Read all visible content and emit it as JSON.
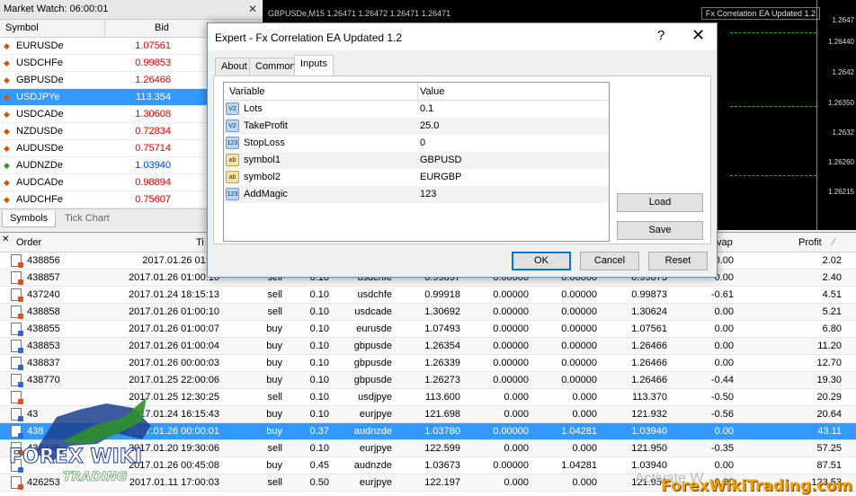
{
  "market_watch": {
    "title": "Market Watch: 06:00:01",
    "col_symbol": "Symbol",
    "col_bid": "Bid",
    "rows": [
      {
        "symbol": "EURUSDe",
        "bid": "1.07561"
      },
      {
        "symbol": "USDCHFe",
        "bid": "0.99853"
      },
      {
        "symbol": "GBPUSDe",
        "bid": "1.26466"
      },
      {
        "symbol": "USDJPYe",
        "bid": "113.354"
      },
      {
        "symbol": "USDCADe",
        "bid": "1.30608"
      },
      {
        "symbol": "NZDUSDe",
        "bid": "0.72834"
      },
      {
        "symbol": "AUDUSDe",
        "bid": "0.75714"
      },
      {
        "symbol": "AUDNZDe",
        "bid": "1.03940"
      },
      {
        "symbol": "AUDCADe",
        "bid": "0.98894"
      },
      {
        "symbol": "AUDCHFe",
        "bid": "0.75607"
      }
    ],
    "tabs": [
      "Symbols",
      "Tick Chart"
    ]
  },
  "chart": {
    "title": "GBPUSDe,M15  1.26471 1.26472 1.26471 1.26471",
    "ea_label": "Fx Correlation EA Updated 1.2",
    "price_labels": [
      "1.2647",
      "1.26440",
      "1.2642",
      "1.26350",
      "1.2632",
      "1.26260",
      "1.26215"
    ]
  },
  "dialog": {
    "title": "Expert - Fx Correlation EA Updated 1.2",
    "help": "?",
    "close": "✕",
    "tabs": [
      "About",
      "Common",
      "Inputs"
    ],
    "grid_headers": {
      "variable": "Variable",
      "value": "Value"
    },
    "inputs": [
      {
        "type": "V2",
        "name": "Lots",
        "value": "0.1"
      },
      {
        "type": "V2",
        "name": "TakeProfit",
        "value": "25.0"
      },
      {
        "type": "123",
        "name": "StopLoss",
        "value": "0"
      },
      {
        "type": "ab",
        "name": "symbol1",
        "value": "GBPUSD"
      },
      {
        "type": "ab",
        "name": "symbol2",
        "value": "EURGBP"
      },
      {
        "type": "123",
        "name": "AddMagic",
        "value": "123"
      }
    ],
    "buttons": {
      "load": "Load",
      "save": "Save",
      "ok": "OK",
      "cancel": "Cancel",
      "reset": "Reset"
    }
  },
  "terminal": {
    "headers": {
      "order": "Order",
      "time": "Ti",
      "swap": "vap",
      "profit": "Profit"
    },
    "rows": [
      {
        "order": "438856",
        "time": "2017.01.26 01:00",
        "type": "",
        "size": "",
        "symbol": "",
        "price": "",
        "sl": "",
        "tp": "",
        "cur": "",
        "swap": "0.00",
        "profit": "2.02"
      },
      {
        "order": "438857",
        "time": "2017.01.26 01:00:10",
        "type": "sell",
        "size": "0.10",
        "symbol": "usdchfe",
        "price": "0.99897",
        "sl": "0.00000",
        "tp": "0.00000",
        "cur": "0.99873",
        "swap": "0.00",
        "profit": "2.40"
      },
      {
        "order": "437240",
        "time": "2017.01.24 18:15:13",
        "type": "sell",
        "size": "0.10",
        "symbol": "usdchfe",
        "price": "0.99918",
        "sl": "0.00000",
        "tp": "0.00000",
        "cur": "0.99873",
        "swap": "-0.61",
        "profit": "4.51"
      },
      {
        "order": "438858",
        "time": "2017.01.26 01:00:10",
        "type": "sell",
        "size": "0.10",
        "symbol": "usdcade",
        "price": "1.30692",
        "sl": "0.00000",
        "tp": "0.00000",
        "cur": "1.30624",
        "swap": "0.00",
        "profit": "5.21"
      },
      {
        "order": "438855",
        "time": "2017.01.26 01:00:07",
        "type": "buy",
        "size": "0.10",
        "symbol": "eurusde",
        "price": "1.07493",
        "sl": "0.00000",
        "tp": "0.00000",
        "cur": "1.07561",
        "swap": "0.00",
        "profit": "6.80"
      },
      {
        "order": "438853",
        "time": "2017.01.26 01:00:04",
        "type": "buy",
        "size": "0.10",
        "symbol": "gbpusde",
        "price": "1.26354",
        "sl": "0.00000",
        "tp": "0.00000",
        "cur": "1.26466",
        "swap": "0.00",
        "profit": "11.20"
      },
      {
        "order": "438837",
        "time": "2017.01.26 00:00:03",
        "type": "buy",
        "size": "0.10",
        "symbol": "gbpusde",
        "price": "1.26339",
        "sl": "0.00000",
        "tp": "0.00000",
        "cur": "1.26466",
        "swap": "0.00",
        "profit": "12.70"
      },
      {
        "order": "438770",
        "time": "2017.01.25 22:00:06",
        "type": "buy",
        "size": "0.10",
        "symbol": "gbpusde",
        "price": "1.26273",
        "sl": "0.00000",
        "tp": "0.00000",
        "cur": "1.26466",
        "swap": "-0.44",
        "profit": "19.30"
      },
      {
        "order": "",
        "time": "2017.01.25 12:30:25",
        "type": "sell",
        "size": "0.10",
        "symbol": "usdjpye",
        "price": "113.600",
        "sl": "0.000",
        "tp": "0.000",
        "cur": "113.370",
        "swap": "-0.50",
        "profit": "20.29"
      },
      {
        "order": "43",
        "time": "2017.01.24 16:15:43",
        "type": "buy",
        "size": "0.10",
        "symbol": "eurjpye",
        "price": "121.698",
        "sl": "0.000",
        "tp": "0.000",
        "cur": "121.932",
        "swap": "-0.56",
        "profit": "20.64"
      },
      {
        "order": "438",
        "time": "2017.01.26 00:00:01",
        "type": "buy",
        "size": "0.37",
        "symbol": "audnzde",
        "price": "1.03780",
        "sl": "0.00000",
        "tp": "1.04281",
        "cur": "1.03940",
        "swap": "0.00",
        "profit": "43.11"
      },
      {
        "order": "434336",
        "time": "2017.01.20 19:30:06",
        "type": "sell",
        "size": "0.10",
        "symbol": "eurjpye",
        "price": "122.599",
        "sl": "0.000",
        "tp": "0.000",
        "cur": "121.950",
        "swap": "-0.35",
        "profit": "57.25"
      },
      {
        "order": "",
        "time": "2017.01.26 00:45:08",
        "type": "buy",
        "size": "0.45",
        "symbol": "audnzde",
        "price": "1.03673",
        "sl": "0.00000",
        "tp": "1.04281",
        "cur": "1.03940",
        "swap": "0.00",
        "profit": "87.51"
      },
      {
        "order": "426253",
        "time": "2017.01.11 17:00:03",
        "type": "sell",
        "size": "0.50",
        "symbol": "eurjpye",
        "price": "122.197",
        "sl": "0.000",
        "tp": "0.000",
        "cur": "121.950",
        "swap": "0.00",
        "profit": "123.53"
      }
    ]
  },
  "watermark": {
    "logo_main": "FOREX WIKI",
    "logo_sub": "TRADING",
    "site": "ForexWikiTrading.com",
    "activate": "Activate W"
  }
}
